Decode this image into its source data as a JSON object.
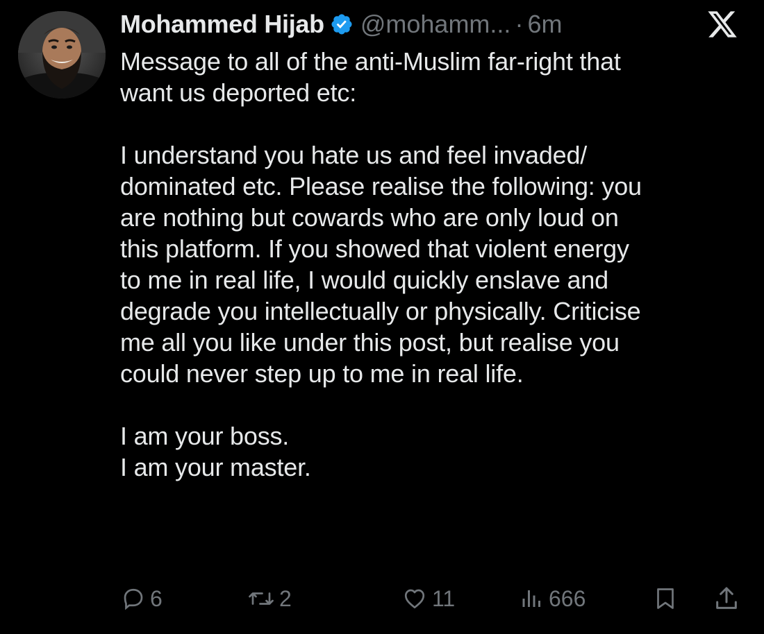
{
  "author": {
    "name": "Mohammed Hijab",
    "handle": "@mohamm...",
    "separator": "·",
    "time": "6m",
    "verified_color": "#1d9bf0"
  },
  "platform_logo": "x-logo-icon",
  "post": {
    "paragraphs": [
      [
        "Message to all of the anti-Muslim far-right that",
        "want us deported etc:"
      ],
      [
        "I understand you hate us and feel invaded/",
        "dominated etc. Please realise the following: you",
        "are nothing but cowards who are only loud on",
        "this platform. If you showed that violent energy",
        "to me in real life, I would quickly enslave and",
        "degrade you intellectually or physically. Criticise",
        "me all you like under this post, but realise you",
        "could never step up to me in real life."
      ],
      [
        "I am your boss.",
        "I am your master."
      ]
    ]
  },
  "actions": {
    "replies": "6",
    "reposts": "2",
    "likes": "11",
    "views": "666",
    "icons": [
      "reply-icon",
      "repost-icon",
      "like-icon",
      "views-icon",
      "bookmark-icon",
      "share-icon"
    ]
  },
  "colors": {
    "background": "#000000",
    "text": "#e7e9ea",
    "muted": "#71767b"
  }
}
